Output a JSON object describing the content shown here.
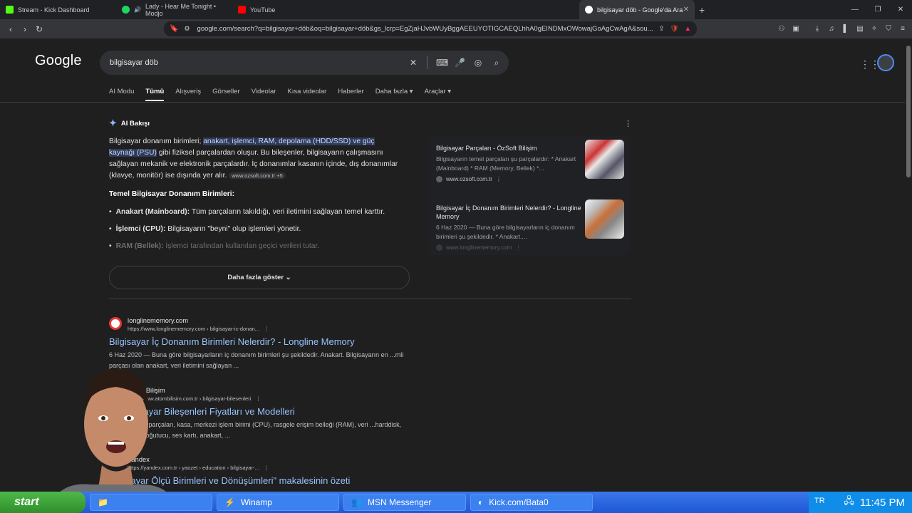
{
  "tabs": [
    {
      "label": "Stream - Kick Dashboard",
      "color": "#53fc18"
    },
    {
      "label": "Lady - Hear Me Tonight • Modjo",
      "color": "#1ed760"
    },
    {
      "label": "YouTube",
      "color": "#ff0000"
    },
    {
      "label": "bilgisayar döb - Google'da Ara",
      "color": "#4285f4"
    }
  ],
  "url": "google.com/search?q=bilgisayar+döb&oq=bilgisayar+döb&gs_lcrp=EgZjaHJvbWUyBggAEEUYOTIGCAEQLhhA0gEINDMxOWowajGoAgCwAgA&sou...",
  "google": {
    "logo": "Google",
    "query": "bilgisayar döb",
    "filters": [
      "AI Modu",
      "Tümü",
      "Alışveriş",
      "Görseller",
      "Videolar",
      "Kısa videolar",
      "Haberler",
      "Daha fazla ▾",
      "Araçlar ▾"
    ]
  },
  "ai": {
    "heading": "AI Bakışı",
    "p_start": "Bilgisayar donanım birimleri; ",
    "p_highlight": "anakart, işlemci, RAM, depolama (HDD/SSD) ve güç kaynağı (PSU)",
    "p_end": " gibi fiziksel parçalardan oluşur. Bu bileşenler, bilgisayarın çalışmasını sağlayan mekanik ve elektronik parçalardır. İç donanımlar kasanın içinde, dış donanımlar (klavye, monitör) ise dışında yer alır.",
    "p_source": "www.ozsoft.com.tr +5",
    "subheading": "Temel Bilgisayar Donanım Birimleri:",
    "items": [
      {
        "bold": "Anakart (Mainboard):",
        "text": " Tüm parçaların takıldığı, veri iletimini sağlayan temel karttır."
      },
      {
        "bold": "İşlemci (CPU):",
        "text": " Bilgisayarın \"beyni\" olup işlemleri yönetir."
      },
      {
        "bold": "RAM (Bellek):",
        "text": " İşlemci tarafından kullanılan geçici verileri tutar."
      }
    ],
    "more_button": "Daha fazla göster"
  },
  "cards": [
    {
      "title": "Bilgisayar Parçaları - ÖzSoft Bilişim",
      "snippet": "Bilgisayarın temel parçaları şu parçalardır: * Anakart (Mainboard) * RAM (Memory, Bellek) *...",
      "url": "www.ozsoft.com.tr"
    },
    {
      "title": "Bilgisayar İç Donanım Birimleri Nelerdir? - Longline Memory",
      "snippet": "6 Haz 2020 — Buna göre bilgisayarların iç donanım birimleri şu şekildedir. * Anakart....",
      "url": "www.longlinememory.com"
    }
  ],
  "results": [
    {
      "site": "longlinememory.com",
      "url": "https://www.longlinememory.com › bilgisayar-ic-donan...",
      "title": "Bilgisayar İç Donanım Birimleri Nelerdir? - Longline Memory",
      "snippet": "6 Haz 2020 — Buna göre bilgisayarların iç donanım birimleri şu şekildedir. Anakart. Bilgisayarın en ...mli parçası olan anakart, veri iletimini sağlayan ..."
    },
    {
      "site": "...tom Bilişim",
      "url": "...ps://www.atombilisim.com.tr › bilgisayar-bilesenleri",
      "title": "...i Bilgisayar Bileşenleri Fiyatları ve Modelleri",
      "snippet": "...ar donanım parçaları, kasa, merkezi işlem birimi (CPU), rasgele erişim belleği (RAM), veri ...harddisk, grafik kartı, soğutucu, ses kartı, anakart, ..."
    },
    {
      "site": "Yandex",
      "url": "https://yandex.com.tr › yaozet › education › bilgisayar-...",
      "title": "...lgisayar Ölçü Birimleri ve Dönüşümleri\" makalesinin özeti",
      "snippet": ""
    }
  ],
  "taskbar": {
    "start": "start",
    "items": [
      "",
      "Winamp",
      "MSN Messenger",
      "Kick.com/Bata0"
    ],
    "lang": "TR",
    "clock": "11:45 PM"
  }
}
